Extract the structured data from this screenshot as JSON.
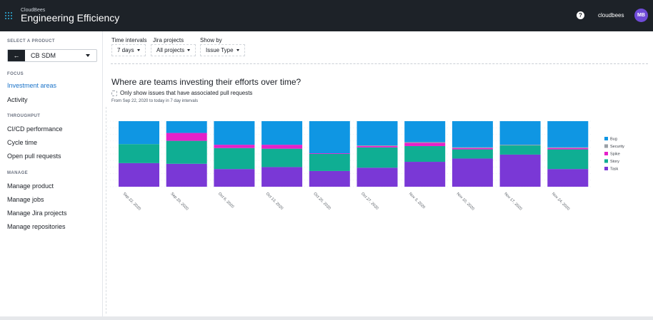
{
  "header": {
    "brand_small": "CloudBees",
    "app_title": "Engineering Efficiency",
    "org_name": "cloudbees",
    "avatar_initials": "MB",
    "help_glyph": "?"
  },
  "sidebar": {
    "select_product_heading": "SELECT A PRODUCT",
    "back_glyph": "←",
    "product_value": "CB SDM",
    "focus_heading": "FOCUS",
    "focus_items": [
      "Investment areas",
      "Activity"
    ],
    "throughput_heading": "THROUGHPUT",
    "throughput_items": [
      "CI/CD performance",
      "Cycle time",
      "Open pull requests"
    ],
    "manage_heading": "MANAGE",
    "manage_items": [
      "Manage product",
      "Manage jobs",
      "Manage Jira projects",
      "Manage repositories"
    ]
  },
  "filters": {
    "time_label": "Time intervals",
    "time_value": "7 days",
    "jira_label": "Jira projects",
    "jira_value": "All projects",
    "showby_label": "Show by",
    "showby_value": "Issue Type"
  },
  "main": {
    "title": "Where are teams investing their efforts over time?",
    "checkbox_label": "Only show issues that have associated pull requests",
    "range_note": "From Sep 22, 2020 to today in 7 day intervals"
  },
  "colors": {
    "Bug": "#0f96e3",
    "Security": "#9aa0a6",
    "Spike": "#e521c9",
    "Story": "#0fae93",
    "Task": "#7a38d6"
  },
  "chart_data": {
    "type": "bar",
    "stacked": true,
    "categories": [
      "Sep 22, 2020",
      "Sep 29, 2020",
      "Oct 6, 2020",
      "Oct 13, 2020",
      "Oct 20, 2020",
      "Oct 27, 2020",
      "Nov 3, 2020",
      "Nov 10, 2020",
      "Nov 17, 2020",
      "Nov 24, 2020"
    ],
    "legend_position": "right",
    "series": [
      {
        "name": "Task",
        "values": [
          36,
          35,
          27,
          30,
          24,
          29,
          38,
          43,
          49,
          27
        ]
      },
      {
        "name": "Story",
        "values": [
          29,
          35,
          32,
          28,
          26,
          31,
          24,
          14,
          14,
          30
        ]
      },
      {
        "name": "Spike",
        "values": [
          0,
          12,
          5,
          6,
          1,
          2,
          5,
          2,
          0,
          2
        ]
      },
      {
        "name": "Security",
        "values": [
          0,
          0,
          0,
          0,
          0,
          1,
          1,
          1,
          1,
          1
        ]
      },
      {
        "name": "Bug",
        "values": [
          35,
          18,
          36,
          36,
          49,
          37,
          32,
          40,
          36,
          40
        ]
      }
    ],
    "ylim": [
      0,
      100
    ]
  }
}
